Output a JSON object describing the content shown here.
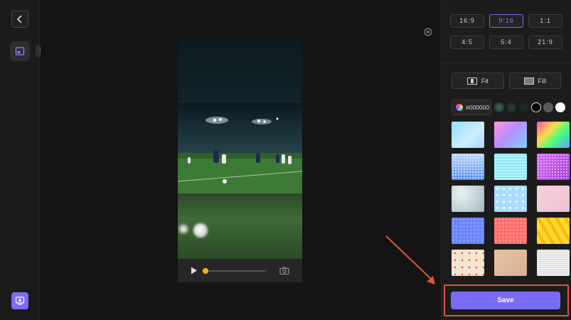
{
  "rail": {
    "tooltip": "Resize"
  },
  "player": {
    "progress": 0.05
  },
  "ratios": [
    {
      "label": "16:9",
      "active": false
    },
    {
      "label": "9:16",
      "active": true
    },
    {
      "label": "1:1",
      "active": false
    },
    {
      "label": "4:5",
      "active": false
    },
    {
      "label": "5:4",
      "active": false
    },
    {
      "label": "21:9",
      "active": false
    }
  ],
  "fit": {
    "fit_label": "Fit",
    "fill_label": "Fill"
  },
  "color": {
    "hex": "#000000",
    "solid_swatches": [
      "#000000",
      "#5a5a5a",
      "#ffffff"
    ]
  },
  "backgrounds": [
    "sky-gradient",
    "pink-violet-gradient",
    "rainbow-gradient",
    "blue-dots",
    "cyan-waves",
    "purple-mesh",
    "frost-texture",
    "light-blue-texture",
    "pink-texture",
    "blue-pattern",
    "coral-pattern",
    "yellow-stripes",
    "confetti-cream",
    "beige-texture",
    "white-wood"
  ],
  "save_label": "Save",
  "accent": "#7b6cf6",
  "highlight": "#d9573a"
}
